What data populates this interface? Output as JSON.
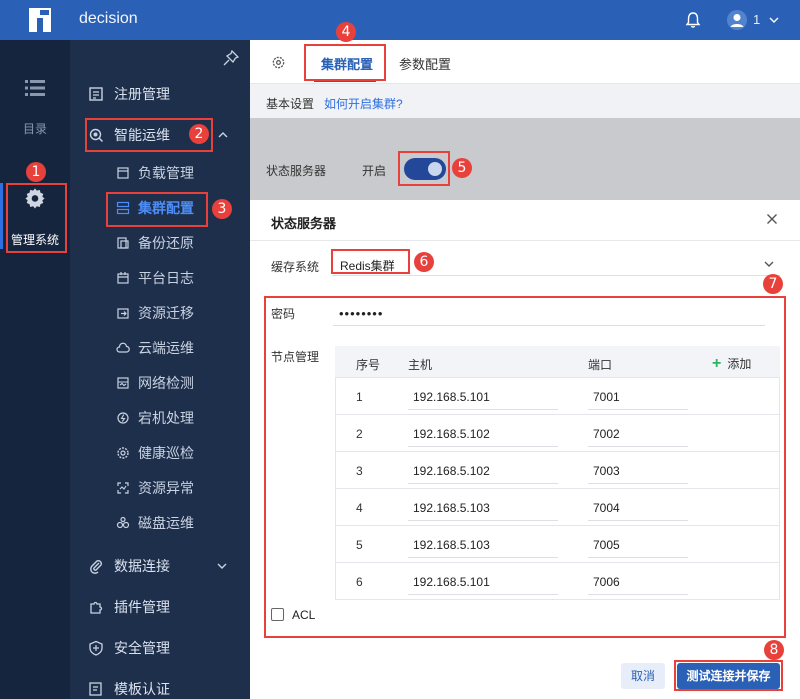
{
  "topbar": {
    "app_title": "decision",
    "user_name": "1"
  },
  "rail": {
    "catalog_label": "目录",
    "admin_label": "管理系统"
  },
  "sidebar": {
    "register": "注册管理",
    "smart_ops": "智能运维",
    "sub_items": [
      "负载管理",
      "集群配置",
      "备份还原",
      "平台日志",
      "资源迁移",
      "云端运维",
      "网络检测",
      "宕机处理",
      "健康巡检",
      "资源异常",
      "磁盘运维"
    ],
    "data_conn": "数据连接",
    "plugin_mgmt": "插件管理",
    "security_mgmt": "安全管理",
    "template_auth": "模板认证"
  },
  "tabs": {
    "cluster_config": "集群配置",
    "param_config": "参数配置"
  },
  "subheader": {
    "basic_settings": "基本设置",
    "how_to_link": "如何开启集群?"
  },
  "status_server": {
    "label": "状态服务器",
    "value": "开启",
    "enabled": true
  },
  "modal": {
    "title": "状态服务器",
    "cache_label": "缓存系统",
    "cache_value": "Redis集群",
    "password_label": "密码",
    "password_value": "••••••••",
    "nodes_label": "节点管理",
    "table": {
      "headers": {
        "index": "序号",
        "host": "主机",
        "port": "端口",
        "add": "添加"
      },
      "rows": [
        {
          "index": "1",
          "host": "192.168.5.101",
          "port": "7001"
        },
        {
          "index": "2",
          "host": "192.168.5.102",
          "port": "7002"
        },
        {
          "index": "3",
          "host": "192.168.5.102",
          "port": "7003"
        },
        {
          "index": "4",
          "host": "192.168.5.103",
          "port": "7004"
        },
        {
          "index": "5",
          "host": "192.168.5.103",
          "port": "7005"
        },
        {
          "index": "6",
          "host": "192.168.5.101",
          "port": "7006"
        }
      ]
    },
    "acl_label": "ACL",
    "cancel_label": "取消",
    "save_label": "测试连接并保存"
  },
  "annotations": [
    "1",
    "2",
    "3",
    "4",
    "5",
    "6",
    "7",
    "8"
  ],
  "colors": {
    "topbar": "#2a61b6",
    "rail": "#16253e",
    "sidebar": "#1e2f4c",
    "highlight": "#e8413c",
    "primary": "#2a61b6"
  }
}
